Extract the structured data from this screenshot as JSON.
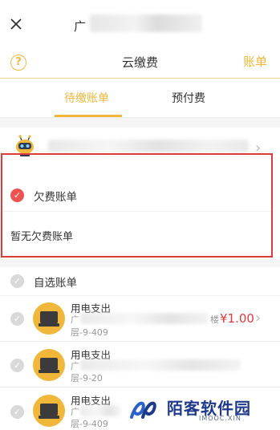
{
  "topbar": {
    "title_prefix": "广"
  },
  "header": {
    "help_glyph": "?",
    "title": "云缴费",
    "action": "账单"
  },
  "tabs": [
    {
      "label": "待缴账单",
      "active": true
    },
    {
      "label": "预付费",
      "active": false
    }
  ],
  "arrears": {
    "label": "欠费账单",
    "empty_text": "暂无欠费账单",
    "check_glyph": "✓"
  },
  "optional": {
    "label": "自选账单",
    "check_glyph": "✓",
    "items": [
      {
        "title": "用电支出",
        "addr_char": "广",
        "tail": "楼",
        "sub": "层-9-409",
        "amount": "¥1.00"
      },
      {
        "title": "用电支出",
        "addr_char": "广",
        "sub": "层-9-20"
      },
      {
        "title": "用电支出",
        "addr_char": "广",
        "sub": "层-9-409"
      }
    ]
  },
  "watermark": {
    "name": "陌客软件园",
    "url": "IMOOC.XIN"
  },
  "colors": {
    "accent": "#f0b73b",
    "highlight": "#e0393e",
    "check": "#ef5350"
  }
}
